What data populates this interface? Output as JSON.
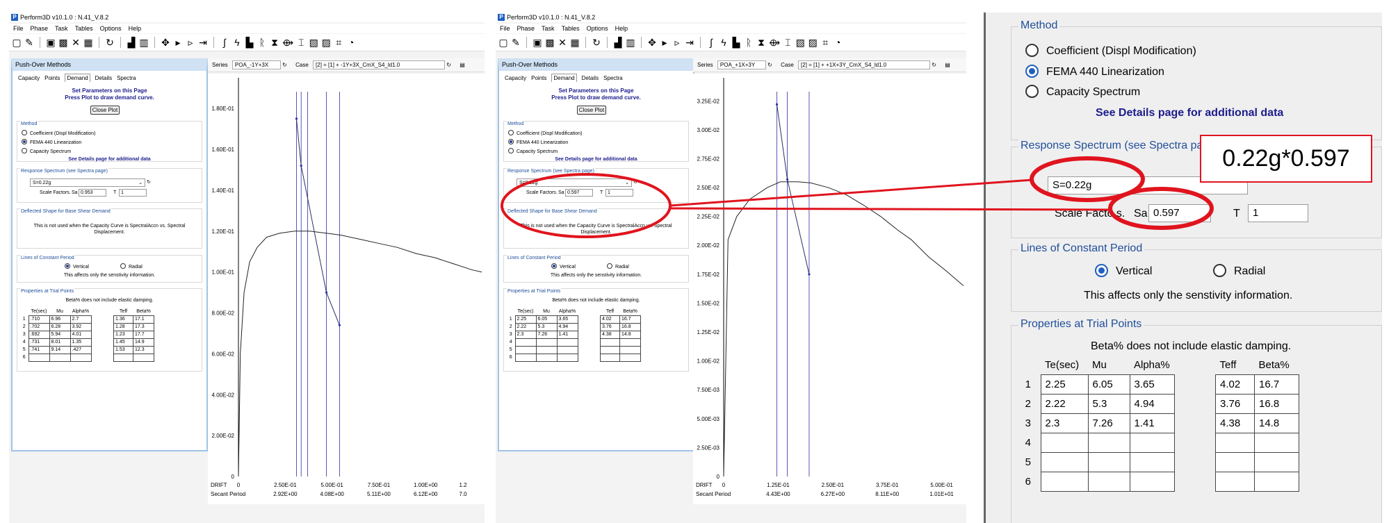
{
  "app": {
    "title": "Perform3D v10.1.0 : N.41_V.8.2"
  },
  "menu": [
    "File",
    "Phase",
    "Task",
    "Tables",
    "Options",
    "Help"
  ],
  "toolbar_icons": [
    "new-icon",
    "open-icon",
    "save-icon",
    "save-as-icon",
    "close-icon",
    "grid-icon",
    "refresh-icon",
    "chart-icon",
    "frame-icon",
    "move-icon",
    "play-icon",
    "step-icon",
    "step-back-icon",
    "curve-icon",
    "lightning-icon",
    "building-icon",
    "hinge-icon",
    "spring-icon",
    "shear-icon",
    "bolt-icon",
    "pushover-icon",
    "pushover-alt-icon",
    "graph-icon",
    "clock-icon"
  ],
  "panel": {
    "title": "Push-Over Methods",
    "tabs": [
      "Capacity",
      "Points",
      "Demand",
      "Details",
      "Spectra"
    ],
    "active_tab": "Demand",
    "instruction_1": "Set Parameters on this Page",
    "instruction_2": "Press Plot to draw demand curve.",
    "close_plot": "Close Plot",
    "method_title": "Method",
    "methods": [
      "Coefficient (Displ Modification)",
      "FEMA 440 Linearization",
      "Capacity Spectrum"
    ],
    "selected_method": "FEMA 440 Linearization",
    "details_note": "See Details page for additional data",
    "response_title": "Response Spectrum (see Spectra page)",
    "spectrum_value": "S=0.22g",
    "scale_label": "Scale Factors.",
    "sa_label": "Sa",
    "t_label": "T",
    "deflected_title": "Deflected Shape for Base Shear Demand",
    "deflected_note": "This is not used when the Capacity Curve is SpectralAccn vs. Spectral Displacement.",
    "lines_title": "Lines of Constant Period",
    "line_options": [
      "Vertical",
      "Radial"
    ],
    "selected_line": "Vertical",
    "sensitivity_note": "This affects only the senstivity information.",
    "props_title": "Properties at Trial Points",
    "beta_note": "Beta% does not include elastic damping.",
    "columns_a": [
      "Te(sec)",
      "Mu",
      "Alpha%"
    ],
    "columns_b": [
      "Teff",
      "Beta%"
    ],
    "row_numbers": [
      "1",
      "2",
      "3",
      "4",
      "5",
      "6"
    ]
  },
  "left": {
    "series_label": "Series",
    "series_value": "POA_-1Y+3X",
    "case_label": "Case",
    "case_value": "[2] = [1] + -1Y+3X_CmX_S4_ld1.0",
    "sa_value": "0.953",
    "t_value": "1",
    "rows_a": [
      [
        ".710",
        "6.96",
        "2.7"
      ],
      [
        ".702",
        "6.28",
        "3.92"
      ],
      [
        ".692",
        "5.94",
        "4.01"
      ],
      [
        ".731",
        "8.01",
        "1.35"
      ],
      [
        ".741",
        "9.14",
        ".427"
      ],
      [
        "",
        "",
        ""
      ]
    ],
    "rows_b": [
      [
        "1.36",
        "17.1"
      ],
      [
        "1.28",
        "17.3"
      ],
      [
        "1.23",
        "17.7"
      ],
      [
        "1.45",
        "14.9"
      ],
      [
        "1.53",
        "12.3"
      ],
      [
        "",
        ""
      ]
    ]
  },
  "middle": {
    "series_label": "Series",
    "series_value": "POA_+1X+3Y",
    "case_label": "Case",
    "case_value": "[2] = [1] + +1X+3Y_CmX_S4_ld1.0",
    "sa_value": "0.597",
    "t_value": "1",
    "rows_a": [
      [
        "2.25",
        "6.05",
        "3.65"
      ],
      [
        "2.22",
        "5.3",
        "4.94"
      ],
      [
        "2.3",
        "7.26",
        "1.41"
      ],
      [
        "",
        "",
        ""
      ],
      [
        "",
        "",
        ""
      ],
      [
        "",
        "",
        ""
      ]
    ],
    "rows_b": [
      [
        "4.02",
        "16.7"
      ],
      [
        "3.76",
        "16.8"
      ],
      [
        "4.38",
        "14.8"
      ],
      [
        "",
        ""
      ],
      [
        "",
        ""
      ],
      [
        "",
        ""
      ]
    ]
  },
  "zoom": {
    "method_title": "Method",
    "methods": [
      "Coefficient (Displ Modification)",
      "FEMA 440 Linearization",
      "Capacity Spectrum"
    ],
    "details_note": "See Details page for additional data",
    "response_title": "Response Spectrum (see Spectra pa",
    "spectrum_value": "S=0.22g",
    "scale_label": "Scale Facto   s.",
    "sa_label": "Sa",
    "sa_value": "0.597",
    "t_label": "T",
    "t_value": "1",
    "lines_title": "Lines of Constant Period",
    "line_options": [
      "Vertical",
      "Radial"
    ],
    "sensitivity_note": "This affects only the senstivity information.",
    "props_title": "Properties at Trial Points",
    "beta_note": "Beta% does not include elastic damping.",
    "columns_a": [
      "Te(sec)",
      "Mu",
      "Alpha%"
    ],
    "columns_b": [
      "Teff",
      "Beta%"
    ],
    "row_numbers": [
      "1",
      "2",
      "3",
      "4",
      "5",
      "6"
    ],
    "rows_a": [
      [
        "2.25",
        "6.05",
        "3.65"
      ],
      [
        "2.22",
        "5.3",
        "4.94"
      ],
      [
        "2.3",
        "7.26",
        "1.41"
      ],
      [
        "",
        "",
        ""
      ],
      [
        "",
        "",
        ""
      ],
      [
        "",
        "",
        ""
      ]
    ],
    "rows_b": [
      [
        "4.02",
        "16.7"
      ],
      [
        "3.76",
        "16.8"
      ],
      [
        "4.38",
        "14.8"
      ],
      [
        "",
        ""
      ],
      [
        "",
        ""
      ],
      [
        "",
        ""
      ]
    ]
  },
  "callout": {
    "text": "0.22g*0.597"
  },
  "chart_data": [
    {
      "type": "line",
      "x_axis_label": "DRIFT",
      "x2_axis_label": "Secant Period",
      "y_ticks": [
        "0",
        "2.00E-02",
        "4.00E-02",
        "6.00E-02",
        "8.00E-02",
        "1.00E-01",
        "1.20E-01",
        "1.40E-01",
        "1.60E-01",
        "1.80E-01"
      ],
      "x_ticks": [
        "0",
        "2.50E-01",
        "5.00E-01",
        "7.50E-01",
        "1.00E+00",
        "1.2"
      ],
      "x2_ticks": [
        "2.92E+00",
        "4.08E+00",
        "5.11E+00",
        "6.12E+00",
        "7.0"
      ],
      "xlim": [
        0,
        1.3
      ],
      "ylim": [
        0,
        0.195
      ],
      "series": [
        {
          "x": [
            0,
            0.01,
            0.03,
            0.06,
            0.1,
            0.15,
            0.22,
            0.3,
            0.38,
            0.47,
            0.55,
            0.65,
            0.75,
            0.85,
            0.95,
            1.05,
            1.15,
            1.25,
            1.3
          ],
          "values": [
            0,
            0.06,
            0.09,
            0.105,
            0.112,
            0.117,
            0.119,
            0.12,
            0.12,
            0.119,
            0.118,
            0.116,
            0.114,
            0.112,
            0.109,
            0.107,
            0.104,
            0.101,
            0.1
          ]
        },
        {
          "x": [
            0.31,
            0.335,
            0.47,
            0.54
          ],
          "values": [
            0.175,
            0.152,
            0.09,
            0.074
          ]
        }
      ],
      "trial_x": [
        0.31,
        0.335,
        0.37,
        0.47,
        0.54
      ]
    },
    {
      "type": "line",
      "x_axis_label": "DRIFT",
      "x2_axis_label": "Secant Period",
      "y_ticks": [
        "0",
        "2.50E-03",
        "5.00E-03",
        "7.50E-03",
        "1.00E-02",
        "1.25E-02",
        "1.50E-02",
        "1.75E-02",
        "2.00E-02",
        "2.25E-02",
        "2.50E-02",
        "2.75E-02",
        "3.00E-02",
        "3.25E-02"
      ],
      "x_ticks": [
        "0",
        "1.25E-01",
        "2.50E-01",
        "3.75E-01",
        "5.00E-01"
      ],
      "x2_ticks": [
        "4.43E+00",
        "6.27E+00",
        "8.11E+00",
        "1.01E+01"
      ],
      "xlim": [
        0,
        0.55
      ],
      "ylim": [
        0,
        0.0345
      ],
      "series": [
        {
          "x": [
            0,
            0.01,
            0.03,
            0.06,
            0.1,
            0.13,
            0.17,
            0.2,
            0.24,
            0.28,
            0.32,
            0.36,
            0.4,
            0.43,
            0.47,
            0.51,
            0.55
          ],
          "values": [
            0,
            0.0205,
            0.0225,
            0.024,
            0.025,
            0.0255,
            0.0255,
            0.0254,
            0.025,
            0.0244,
            0.0235,
            0.0225,
            0.0213,
            0.0205,
            0.019,
            0.0178,
            0.0165
          ]
        },
        {
          "x": [
            0.122,
            0.146,
            0.196
          ],
          "values": [
            0.0322,
            0.0257,
            0.0175
          ]
        }
      ],
      "trial_x": [
        0.122,
        0.146,
        0.196
      ]
    }
  ]
}
